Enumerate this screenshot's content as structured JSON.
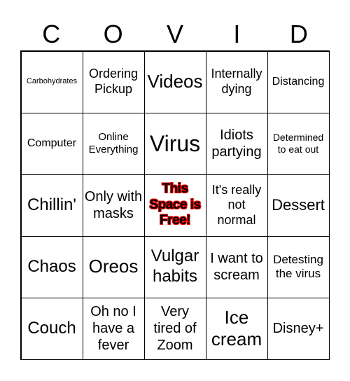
{
  "header": {
    "letters": [
      "C",
      "O",
      "V",
      "I",
      "D"
    ]
  },
  "cells": [
    "Carbohydrates",
    "Ordering Pickup",
    "Videos",
    "Internally dying",
    "Distancing",
    "Computer",
    "Online Everything",
    "Virus",
    "Idiots partying",
    "Determined to eat out",
    "Chillin'",
    "Only with masks",
    "This Space is Free!",
    "It's really not normal",
    "Dessert",
    "Chaos",
    "Oreos",
    "Vulgar habits",
    "I want to scream",
    "Detesting the virus",
    "Couch",
    "Oh no I have a fever",
    "Very tired of Zoom",
    "Ice cream",
    "Disney+"
  ],
  "colors": {
    "free_outline": "#e00000",
    "grid_line": "#000000"
  }
}
